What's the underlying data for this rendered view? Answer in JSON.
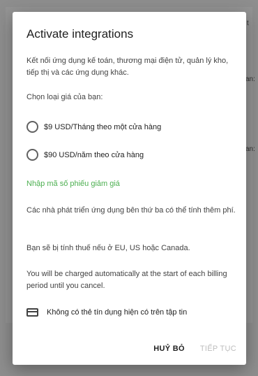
{
  "background": {
    "fragments": [
      "ng t",
      "an:",
      "an:"
    ]
  },
  "dialog": {
    "title": "Activate integrations",
    "description": "Kết nối ứng dụng kế toán, thương mại điện tử, quản lý kho, tiếp thị và các ứng dụng khác.",
    "price_prompt": "Chọn loại giá của bạn:",
    "options": [
      {
        "label": "$9 USD/Tháng theo một cửa hàng",
        "selected": false
      },
      {
        "label": "$90 USD/năm theo cửa hàng",
        "selected": false
      }
    ],
    "coupon_link": "Nhập mã số phiếu giảm giá",
    "notes": [
      "Các nhà phát triển ứng dụng bên thứ ba có thể tính thêm phí.",
      "Bạn sẽ bị tính thuế nếu ở EU, US hoặc Canada.",
      "You will be charged automatically at the start of each billing period until you cancel."
    ],
    "card_status": "Không có thẻ tín dụng hiện có trên tập tin",
    "cancel_label": "HUỶ BỎ",
    "next_label": "TIẾP TỤC"
  },
  "colors": {
    "accent_link": "#4caf50",
    "disabled": "#bdbdbd",
    "scrim": "rgba(0,0,0,0.42)"
  }
}
